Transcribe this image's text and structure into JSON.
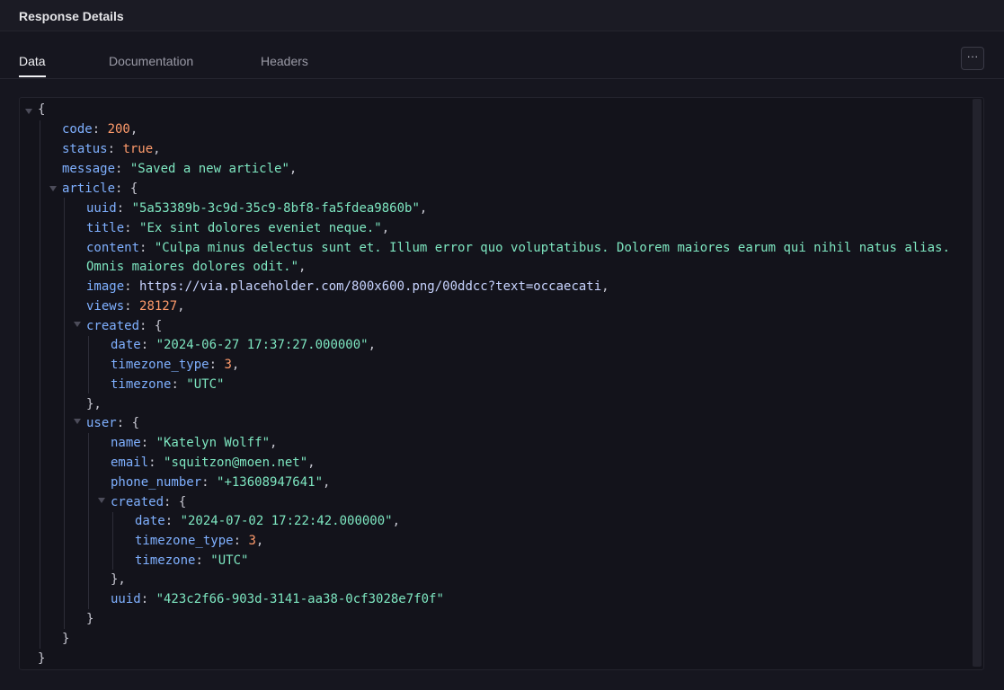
{
  "header": {
    "title": "Response Details"
  },
  "tabs": [
    {
      "label": "Data",
      "active": true
    },
    {
      "label": "Documentation",
      "active": false
    },
    {
      "label": "Headers",
      "active": false
    }
  ],
  "toolbar": {
    "more_label": "···"
  },
  "json": {
    "open_brace": "{",
    "close_brace": "}",
    "code_key": "code",
    "code_val": "200",
    "status_key": "status",
    "status_val": "true",
    "message_key": "message",
    "message_val": "\"Saved a new article\"",
    "article_key": "article",
    "article": {
      "uuid_key": "uuid",
      "uuid_val": "\"5a53389b-3c9d-35c9-8bf8-fa5fdea9860b\"",
      "title_key": "title",
      "title_val": "\"Ex sint dolores eveniet neque.\"",
      "content_key": "content",
      "content_val_1": "\"Culpa minus delectus sunt et. Illum error quo voluptatibus. Dolorem maiores earum qui nihil natus alias.",
      "content_val_2": "Omnis maiores dolores odit.\"",
      "image_key": "image",
      "image_val": "https://via.placeholder.com/800x600.png/00ddcc?text=occaecati",
      "views_key": "views",
      "views_val": "28127",
      "created_key": "created",
      "created": {
        "date_key": "date",
        "date_val": "\"2024-06-27 17:37:27.000000\"",
        "tzt_key": "timezone_type",
        "tzt_val": "3",
        "tz_key": "timezone",
        "tz_val": "\"UTC\""
      },
      "user_key": "user",
      "user": {
        "name_key": "name",
        "name_val": "\"Katelyn Wolff\"",
        "email_key": "email",
        "email_val": "\"squitzon@moen.net\"",
        "phone_key": "phone_number",
        "phone_val": "\"+13608947641\"",
        "created_key": "created",
        "created": {
          "date_key": "date",
          "date_val": "\"2024-07-02 17:22:42.000000\"",
          "tzt_key": "timezone_type",
          "tzt_val": "3",
          "tz_key": "timezone",
          "tz_val": "\"UTC\""
        },
        "uuid_key": "uuid",
        "uuid_val": "\"423c2f66-903d-3141-aa38-0cf3028e7f0f\""
      }
    }
  }
}
